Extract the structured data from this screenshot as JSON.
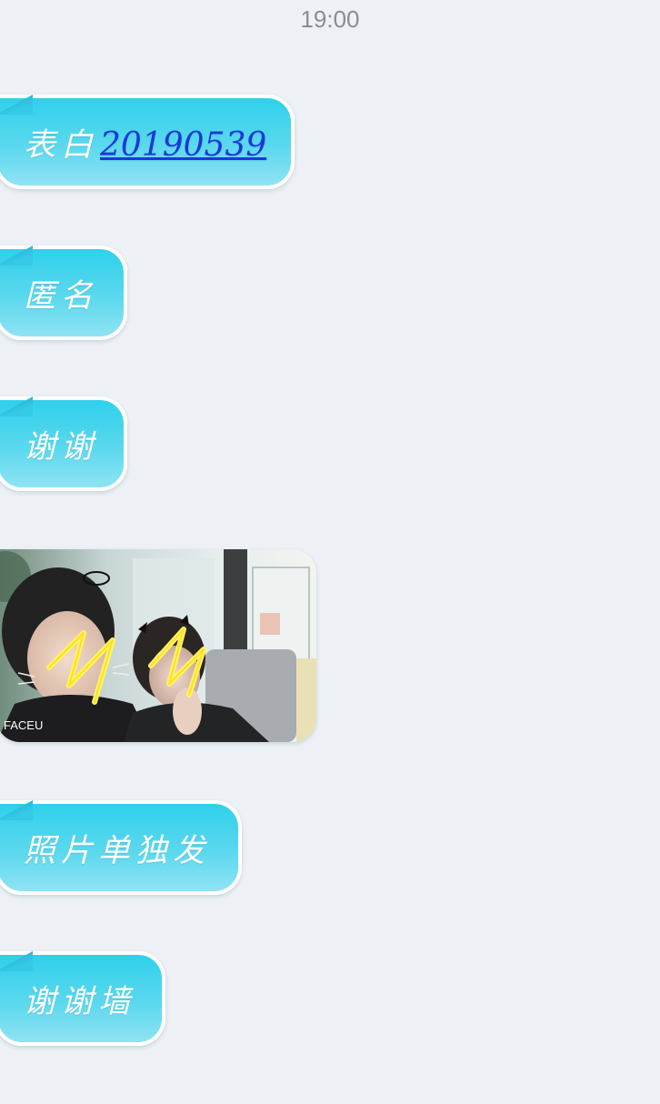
{
  "status": {
    "time": "19:00"
  },
  "messages": [
    {
      "prefix": "表白",
      "link": "20190539"
    },
    {
      "text": "匿名"
    },
    {
      "text": "谢谢"
    },
    {
      "photo_label": "FACEU"
    },
    {
      "text": "照片单独发"
    },
    {
      "text": "谢谢墙"
    }
  ],
  "colors": {
    "bubble": "#4fd5ec",
    "background": "#edf1f5",
    "link": "#1a39d6"
  }
}
